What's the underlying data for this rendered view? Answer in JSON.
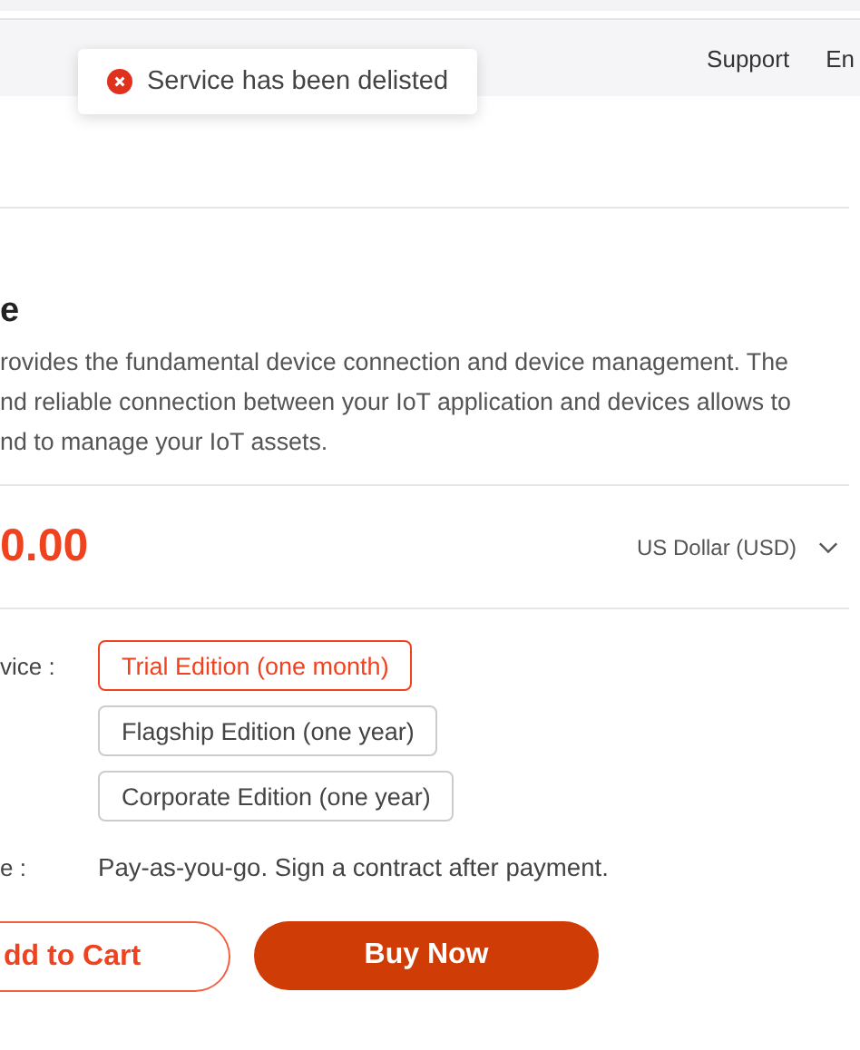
{
  "header": {
    "links": [
      "Support",
      "En"
    ]
  },
  "toast": {
    "kind": "error",
    "message": "Service has been delisted"
  },
  "product": {
    "title": "e",
    "description": "rovides the fundamental device connection and device management. The\nnd reliable connection between your IoT application and devices allows to\nnd to manage your IoT assets.",
    "price": "0.00",
    "currency": "US Dollar (USD)"
  },
  "edition": {
    "label": "vice :",
    "options": [
      {
        "label": "Trial Edition (one month)",
        "selected": true
      },
      {
        "label": "Flagship Edition (one year)",
        "selected": false
      },
      {
        "label": "Corporate Edition (one year)",
        "selected": false
      }
    ]
  },
  "billing": {
    "label": "e :",
    "value": "Pay-as-you-go. Sign a contract after payment."
  },
  "buttons": {
    "add_to_cart": "dd to Cart",
    "buy_now": "Buy Now"
  }
}
